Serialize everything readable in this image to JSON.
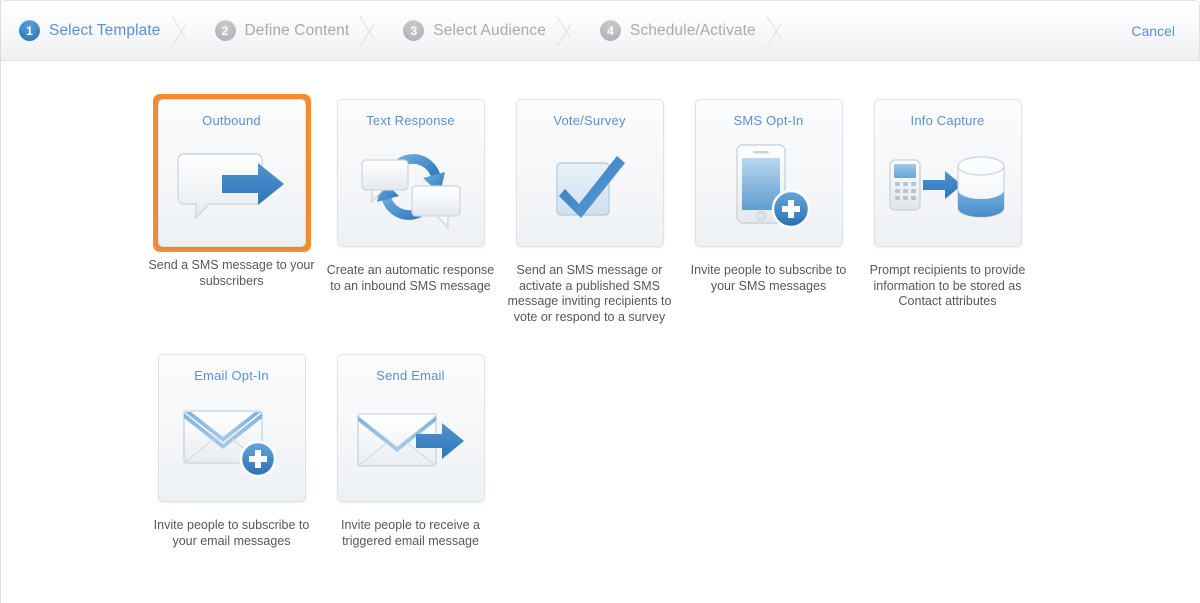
{
  "wizard": {
    "steps": [
      {
        "num": "1",
        "label": "Select Template",
        "state": "active"
      },
      {
        "num": "2",
        "label": "Define Content",
        "state": "inactive"
      },
      {
        "num": "3",
        "label": "Select Audience",
        "state": "inactive"
      },
      {
        "num": "4",
        "label": "Schedule/Activate",
        "state": "inactive"
      }
    ],
    "cancel_label": "Cancel",
    "active_color": "#5c8fd6",
    "inactive_color": "#a8aaad"
  },
  "selection": {
    "selected_index": 0,
    "highlight_color": "#f28b33"
  },
  "templates": [
    {
      "title": "Outbound",
      "icon": "speech-bubble-arrow-icon",
      "caption": "Send a SMS message to your subscribers",
      "selected": true
    },
    {
      "title": "Text Response",
      "icon": "two-bubbles-cycle-icon",
      "caption": "Create an automatic response to an inbound SMS message",
      "selected": false
    },
    {
      "title": "Vote/Survey",
      "icon": "checkbox-check-icon",
      "caption": "Send an SMS message or activate a published SMS message inviting recipients to vote or respond to a survey",
      "selected": false
    },
    {
      "title": "SMS Opt-In",
      "icon": "phone-plus-icon",
      "caption": "Invite people to subscribe to your SMS messages",
      "selected": false
    },
    {
      "title": "Info Capture",
      "icon": "keypad-database-icon",
      "caption": "Prompt recipients to provide information to be stored as Contact attributes",
      "selected": false
    },
    {
      "title": "Email Opt-In",
      "icon": "envelope-plus-icon",
      "caption": "Invite people to subscribe to your email messages",
      "selected": false
    },
    {
      "title": "Send Email",
      "icon": "envelope-arrow-icon",
      "caption": "Invite people to receive a triggered email message",
      "selected": false
    }
  ]
}
